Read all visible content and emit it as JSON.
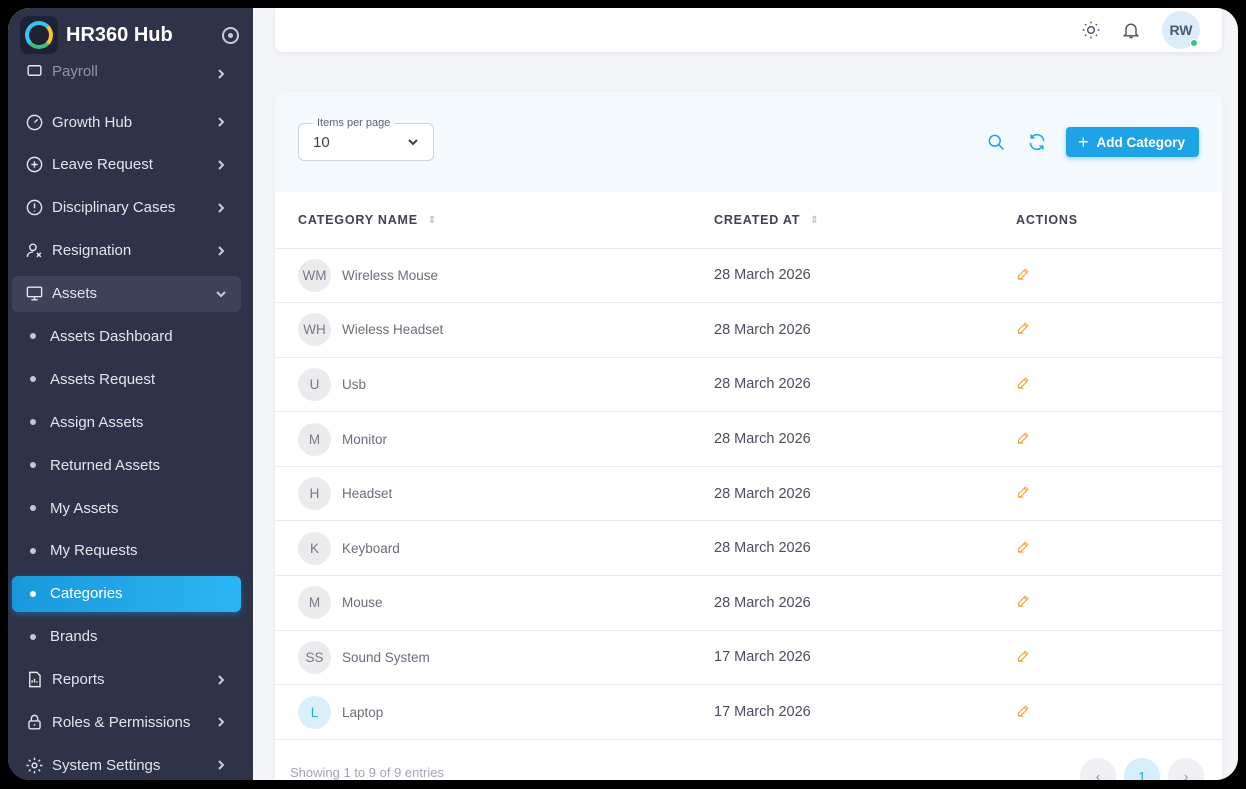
{
  "app": {
    "name": "HR360 Hub"
  },
  "sidebar": {
    "partial_item": "Payroll",
    "items": [
      {
        "label": "Growth Hub",
        "icon": "gauge-icon"
      },
      {
        "label": "Leave Request",
        "icon": "plus-circle-icon"
      },
      {
        "label": "Disciplinary Cases",
        "icon": "alert-circle-icon"
      },
      {
        "label": "Resignation",
        "icon": "user-x-icon"
      },
      {
        "label": "Assets",
        "icon": "monitor-icon"
      }
    ],
    "sub_items": [
      "Assets Dashboard",
      "Assets Request",
      "Assign Assets",
      "Returned Assets",
      "My Assets",
      "My Requests",
      "Categories",
      "Brands"
    ],
    "bottom_items": [
      {
        "label": "Reports",
        "icon": "report-icon"
      },
      {
        "label": "Roles & Permissions",
        "icon": "lock-icon"
      },
      {
        "label": "System Settings",
        "icon": "gear-icon"
      }
    ]
  },
  "topbar": {
    "avatar_initials": "RW"
  },
  "toolbar": {
    "items_per_page_label": "Items per page",
    "items_per_page_value": "10",
    "add_label": "Add Category"
  },
  "table": {
    "headers": [
      "CATEGORY NAME",
      "CREATED AT",
      "ACTIONS"
    ],
    "rows": [
      {
        "initials": "WM",
        "name": "Wireless Mouse",
        "created": "28 March 2026"
      },
      {
        "initials": "WH",
        "name": "Wieless Headset",
        "created": "28 March 2026"
      },
      {
        "initials": "U",
        "name": "Usb",
        "created": "28 March 2026"
      },
      {
        "initials": "M",
        "name": "Monitor",
        "created": "28 March 2026"
      },
      {
        "initials": "H",
        "name": "Headset",
        "created": "28 March 2026"
      },
      {
        "initials": "K",
        "name": "Keyboard",
        "created": "28 March 2026"
      },
      {
        "initials": "M",
        "name": "Mouse",
        "created": "28 March 2026"
      },
      {
        "initials": "SS",
        "name": "Sound System",
        "created": "17 March 2026"
      },
      {
        "initials": "L",
        "name": "Laptop",
        "created": "17 March 2026"
      }
    ]
  },
  "footer": {
    "showing": "Showing 1 to 9 of 9 entries",
    "current_page": "1",
    "prev": "‹",
    "next": "›"
  },
  "colors": {
    "sidebar_bg": "#2f3349",
    "accent": "#1ea3e6",
    "edit": "#f5a43c"
  }
}
